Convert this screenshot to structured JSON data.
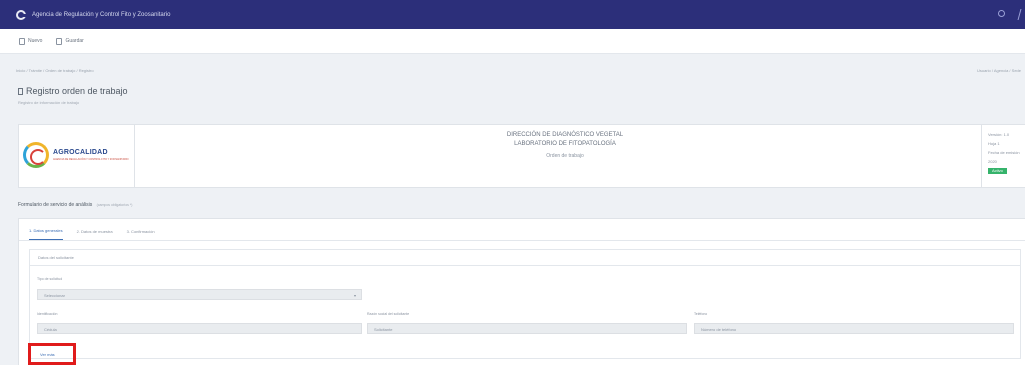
{
  "topbar": {
    "app_title": "Agencia de Regulación y Control Fito y Zoosanitario",
    "logo_icon": "agency-logo-icon",
    "right_icons": [
      "search-icon",
      "user-menu-icon"
    ]
  },
  "toolbar": {
    "buttons": [
      {
        "label": "Nuevo",
        "icon": "file-icon"
      },
      {
        "label": "Guardar",
        "icon": "save-icon"
      }
    ]
  },
  "breadcrumb": "Inicio / Trámite / Orden de trabajo / Registro",
  "breadcrumb_right": "Usuario / Agencia / Sede",
  "page": {
    "title": "Registro orden de trabajo",
    "subtitle": "Registro de información de trabajo"
  },
  "header": {
    "logo_brand": "AGROCALIDAD",
    "logo_tagline": "AGENCIA DE REGULACIÓN Y CONTROL FITO Y ZOOSANITARIO",
    "line1": "DIRECCIÓN DE DIAGNÓSTICO VEGETAL",
    "line2": "LABORATORIO DE FITOPATOLOGÍA",
    "line3": "Orden de trabajo",
    "right_line1": "Versión: 1.0",
    "right_line2": "Hoja 1",
    "right_line3": "Fecha de emisión",
    "right_line4": "2020",
    "status_badge": "Activo",
    "status_color": "#35b36b"
  },
  "section": {
    "title": "Formulario de servicio de análisis",
    "note": "(campos obligatorios *)"
  },
  "tabs": [
    {
      "label": "1. Datos generales",
      "active": true
    },
    {
      "label": "2. Datos de muestra",
      "active": false
    },
    {
      "label": "3. Confirmación",
      "active": false
    }
  ],
  "panel": {
    "heading": "Datos del solicitante",
    "fields": {
      "tipo_label": "Tipo de solicitud",
      "tipo_value": "Seleccionar",
      "ruc_label": "Identificación",
      "ruc_value": "Cédula",
      "razon_label": "Razón social del solicitante",
      "razon_value": "Solicitante",
      "telefono_label": "Teléfono",
      "telefono_value": "Número de teléfono"
    }
  },
  "more_link": "Ver más",
  "highlight_color": "#e01b1b"
}
